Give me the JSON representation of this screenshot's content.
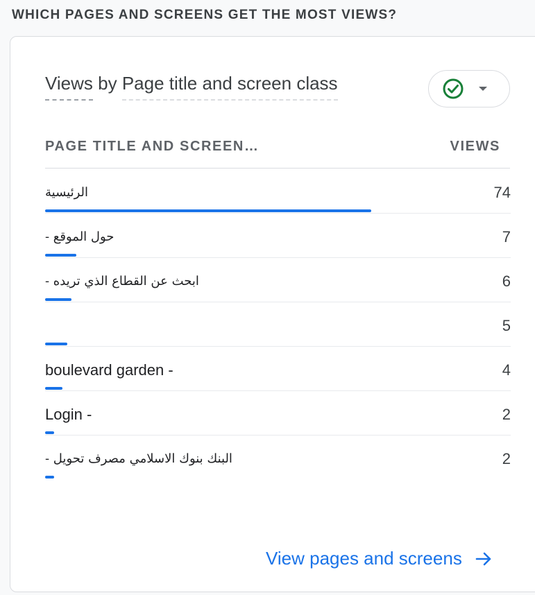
{
  "section_heading": "WHICH PAGES AND SCREENS GET THE MOST VIEWS?",
  "card": {
    "title_part1": "Views",
    "title_part2": "by",
    "title_part3": "Page title and screen class",
    "status_icon": "check-circle-icon",
    "dropdown_icon": "caret-down-icon",
    "accent_color": "#1a73e8",
    "status_color": "#188038"
  },
  "table": {
    "columns": [
      "PAGE TITLE AND SCREEN…",
      "VIEWS"
    ],
    "rows": [
      {
        "label": "الرئيسية",
        "value": "74",
        "share": 1.0
      },
      {
        "label": "حول الموقع -",
        "value": "7",
        "share": 0.095
      },
      {
        "label": "ابحث عن القطاع الذي تريده -",
        "value": "6",
        "share": 0.081
      },
      {
        "label": "",
        "value": "5",
        "share": 0.068
      },
      {
        "label": "boulevard garden -",
        "value": "4",
        "share": 0.054
      },
      {
        "label": "Login -",
        "value": "2",
        "share": 0.027
      },
      {
        "label": "البنك بنوك الاسلامي مصرف تحويل -",
        "value": "2",
        "share": 0.027
      }
    ]
  },
  "footer_link": "View pages and screens",
  "footer_icon": "arrow-right-icon"
}
